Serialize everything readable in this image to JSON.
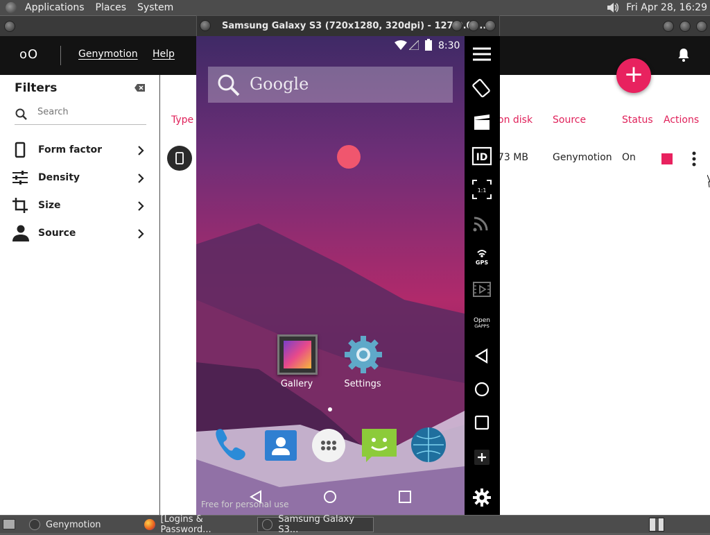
{
  "top_panel": {
    "menus": [
      "Applications",
      "Places",
      "System"
    ],
    "clock": "Fri Apr 28, 16:29"
  },
  "genymotion": {
    "logo": "oO",
    "nav": [
      "Genymotion",
      "Help"
    ],
    "filters": {
      "title": "Filters",
      "search_placeholder": "Search",
      "items": [
        {
          "label": "Form factor",
          "icon": "phone-icon"
        },
        {
          "label": "Density",
          "icon": "sliders-icon"
        },
        {
          "label": "Size",
          "icon": "crop-icon"
        },
        {
          "label": "Source",
          "icon": "person-icon"
        }
      ]
    },
    "columns": {
      "type": "Type",
      "on_disk": "on disk",
      "source": "Source",
      "status": "Status",
      "actions": "Actions"
    },
    "row": {
      "size": "73 MB",
      "source": "Genymotion",
      "status": "On"
    },
    "accent": "#e8225f"
  },
  "emulator": {
    "title": "Samsung Galaxy S3 (720x1280, 320dpi) - 127.0.0....",
    "time": "8:30",
    "search_text": "Google",
    "apps": [
      {
        "label": "Gallery",
        "icon": "gallery-icon"
      },
      {
        "label": "Settings",
        "icon": "settings-gear-icon"
      }
    ],
    "dock": [
      "phone-icon",
      "contacts-icon",
      "app-drawer-icon",
      "messaging-icon",
      "browser-icon"
    ],
    "watermark": "Free for personal use",
    "toolbar": {
      "rotate_label": "rotate",
      "id_label": "ID",
      "scale_label": "1:1",
      "gps_label": "GPS",
      "opengapps_label": "Open\nGAPPS"
    }
  },
  "taskbar": {
    "tasks": [
      "Genymotion",
      "[Logins & Password...",
      "Samsung Galaxy S3..."
    ]
  }
}
